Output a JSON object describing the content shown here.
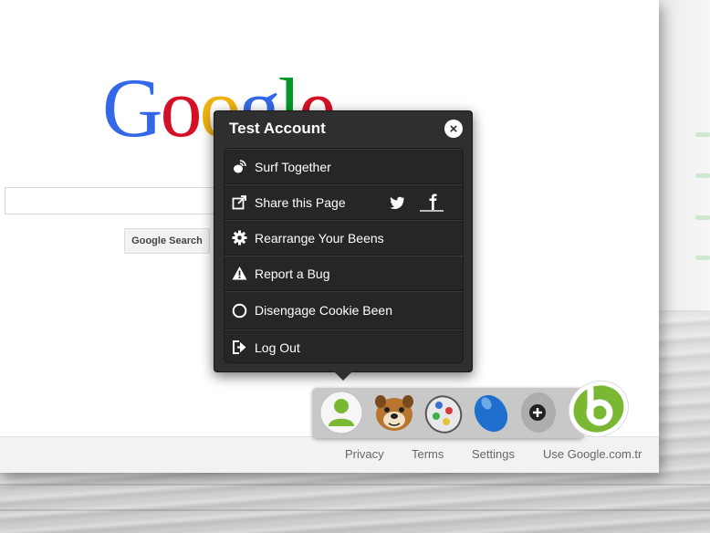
{
  "logo": {
    "letters": [
      "G",
      "o",
      "o",
      "g",
      "l",
      "e"
    ]
  },
  "search": {
    "button_label": "Google Search"
  },
  "footer": {
    "links": [
      "Privacy",
      "Terms",
      "Settings",
      "Use Google.com.tr"
    ]
  },
  "popup": {
    "title": "Test Account",
    "close_label": "×",
    "items": [
      {
        "label": "Surf Together",
        "icon": "surf-together-icon"
      },
      {
        "label": "Share this Page",
        "icon": "share-icon"
      },
      {
        "label": "Rearrange Your Beens",
        "icon": "gear-icon"
      },
      {
        "label": "Report a Bug",
        "icon": "warning-icon"
      },
      {
        "label": "Disengage Cookie Been",
        "icon": "circle-icon"
      },
      {
        "label": "Log Out",
        "icon": "logout-icon"
      }
    ],
    "share_targets": [
      "twitter-icon",
      "facebook-icon"
    ]
  },
  "dock": {
    "items": [
      "user-avatar-icon",
      "dog-been-icon",
      "gamepad-been-icon",
      "blue-bean-icon",
      "add-been-icon",
      "been-logo-icon"
    ]
  },
  "colors": {
    "popup_bg": "#2f2f2f",
    "accent_green": "#7ab833",
    "google_blue": "#3369e8",
    "google_red": "#d50f25",
    "google_yellow": "#eeb211",
    "google_green": "#009925"
  }
}
